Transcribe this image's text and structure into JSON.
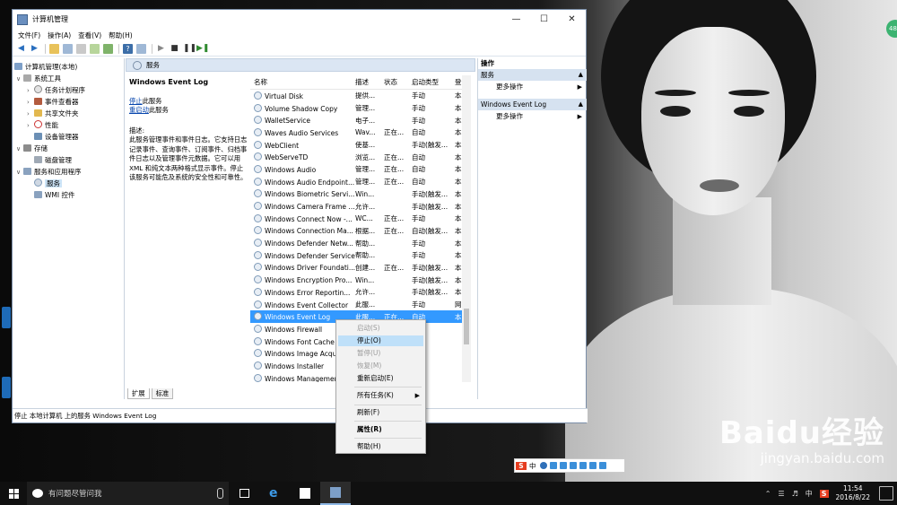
{
  "window": {
    "title": "计算机管理",
    "menu": [
      "文件(F)",
      "操作(A)",
      "查看(V)",
      "帮助(H)"
    ]
  },
  "tree": {
    "root": "计算机管理(本地)",
    "system_tools": "系统工具",
    "task_scheduler": "任务计划程序",
    "event_viewer": "事件查看器",
    "shared_folders": "共享文件夹",
    "performance": "性能",
    "device_manager": "设备管理器",
    "storage": "存储",
    "disk_management": "磁盘管理",
    "services_apps": "服务和应用程序",
    "services": "服务",
    "wmi": "WMI 控件"
  },
  "middle": {
    "header": "服务",
    "selected_service": "Windows Event Log",
    "stop_link": "停止",
    "stop_suffix": "此服务",
    "restart_link": "重启动",
    "restart_suffix": "此服务",
    "desc_label": "描述:",
    "description": "此服务管理事件和事件日志。它支持日志记录事件、查询事件、订阅事件、归档事件日志以及管理事件元数据。它可以用 XML 和纯文本两种格式显示事件。停止该服务可能危及系统的安全性和可靠性。"
  },
  "columns": [
    "名称",
    "描述",
    "状态",
    "启动类型",
    "登"
  ],
  "services": [
    {
      "name": "Virtual Disk",
      "desc": "提供...",
      "status": "",
      "startup": "手动",
      "logon": "本"
    },
    {
      "name": "Volume Shadow Copy",
      "desc": "管理...",
      "status": "",
      "startup": "手动",
      "logon": "本"
    },
    {
      "name": "WalletService",
      "desc": "电子...",
      "status": "",
      "startup": "手动",
      "logon": "本"
    },
    {
      "name": "Waves Audio Services",
      "desc": "Wav...",
      "status": "正在...",
      "startup": "自动",
      "logon": "本"
    },
    {
      "name": "WebClient",
      "desc": "使基...",
      "status": "",
      "startup": "手动(触发...",
      "logon": "本"
    },
    {
      "name": "WebServeTD",
      "desc": "浏览...",
      "status": "正在...",
      "startup": "自动",
      "logon": "本"
    },
    {
      "name": "Windows Audio",
      "desc": "管理...",
      "status": "正在...",
      "startup": "自动",
      "logon": "本"
    },
    {
      "name": "Windows Audio Endpoint...",
      "desc": "管理...",
      "status": "正在...",
      "startup": "自动",
      "logon": "本"
    },
    {
      "name": "Windows Biometric Servi...",
      "desc": "Win...",
      "status": "",
      "startup": "手动(触发...",
      "logon": "本"
    },
    {
      "name": "Windows Camera Frame ...",
      "desc": "允许...",
      "status": "",
      "startup": "手动(触发...",
      "logon": "本"
    },
    {
      "name": "Windows Connect Now -...",
      "desc": "WC...",
      "status": "正在...",
      "startup": "手动",
      "logon": "本"
    },
    {
      "name": "Windows Connection Ma...",
      "desc": "根据...",
      "status": "正在...",
      "startup": "自动(触发...",
      "logon": "本"
    },
    {
      "name": "Windows Defender Netw...",
      "desc": "帮助...",
      "status": "",
      "startup": "手动",
      "logon": "本"
    },
    {
      "name": "Windows Defender Service",
      "desc": "帮助...",
      "status": "",
      "startup": "手动",
      "logon": "本"
    },
    {
      "name": "Windows Driver Foundati...",
      "desc": "创建...",
      "status": "正在...",
      "startup": "手动(触发...",
      "logon": "本"
    },
    {
      "name": "Windows Encryption Pro...",
      "desc": "Win...",
      "status": "",
      "startup": "手动(触发...",
      "logon": "本"
    },
    {
      "name": "Windows Error Reportin...",
      "desc": "允许...",
      "status": "",
      "startup": "手动(触发...",
      "logon": "本"
    },
    {
      "name": "Windows Event Collector",
      "desc": "此服...",
      "status": "",
      "startup": "手动",
      "logon": "网"
    },
    {
      "name": "Windows Event Log",
      "desc": "此服...",
      "status": "正在...",
      "startup": "自动",
      "logon": "本"
    },
    {
      "name": "Windows Firewall",
      "desc": "",
      "status": "",
      "startup": "",
      "logon": ""
    },
    {
      "name": "Windows Font Cache S",
      "desc": "",
      "status": "",
      "startup": "",
      "logon": ""
    },
    {
      "name": "Windows Image Acqu",
      "desc": "",
      "status": "",
      "startup": "",
      "logon": ""
    },
    {
      "name": "Windows Installer",
      "desc": "",
      "status": "",
      "startup": "",
      "logon": ""
    },
    {
      "name": "Windows Managemen",
      "desc": "",
      "status": "",
      "startup": "",
      "logon": ""
    }
  ],
  "tabs": [
    "扩展",
    "标准"
  ],
  "actions": {
    "header": "操作",
    "section1": "服务",
    "more1": "更多操作",
    "section2": "Windows Event Log",
    "more2": "更多操作"
  },
  "status_bar": "停止 本地计算机 上的服务 Windows Event Log",
  "context_menu": {
    "start": "启动(S)",
    "stop": "停止(O)",
    "pause": "暂停(U)",
    "resume": "恢复(M)",
    "restart": "重新启动(E)",
    "all_tasks": "所有任务(K)",
    "refresh": "刷新(F)",
    "properties": "属性(R)",
    "help": "帮助(H)"
  },
  "ime": {
    "logo": "S",
    "lang": "中"
  },
  "taskbar": {
    "search_placeholder": "有问题尽管问我",
    "ime_lang": "中",
    "time": "11:54",
    "date": "2016/8/22"
  },
  "watermark": {
    "logo": "Baidu经验",
    "url": "jingyan.baidu.com"
  },
  "desktop_badge": "48",
  "colors": {
    "selection": "#3399ff",
    "context_highlight": "#bfe0f9",
    "taskbar": "#101010",
    "link": "#0645ad"
  }
}
